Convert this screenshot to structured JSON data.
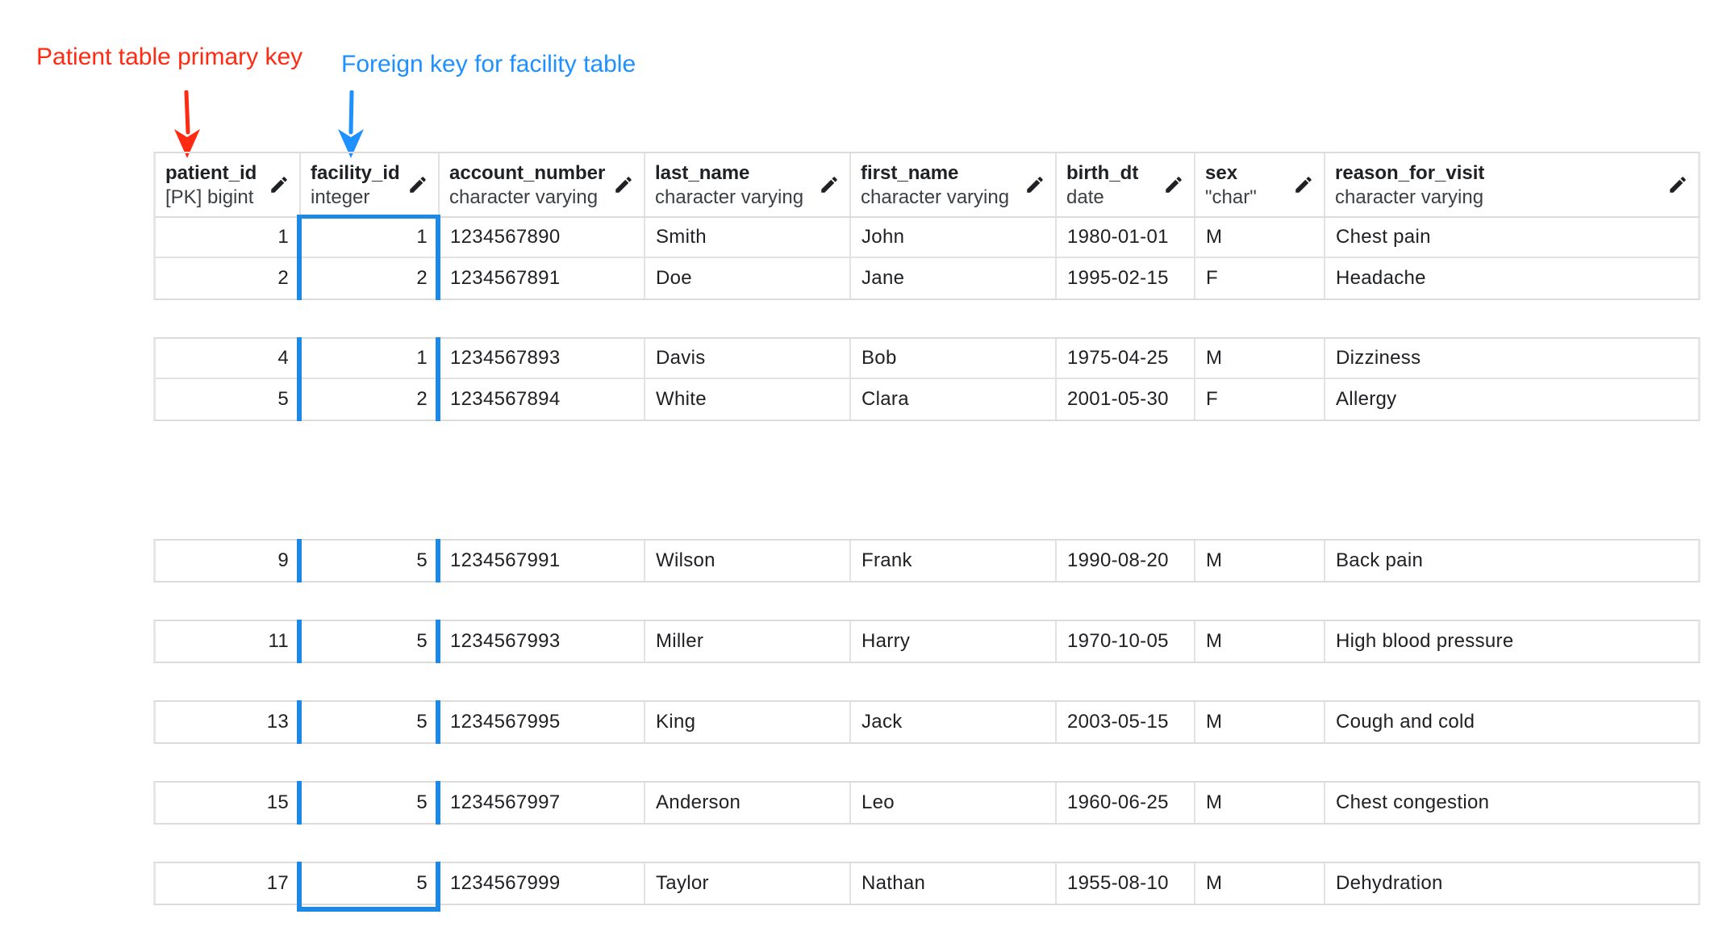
{
  "annotations": {
    "primary_key": "Patient table primary key",
    "foreign_key": "Foreign key for facility table"
  },
  "colors": {
    "primary_key_annotation": "#ff2a12",
    "foreign_key_annotation": "#1e90ff",
    "fk_highlight": "#1e88e5"
  },
  "columns": [
    {
      "name": "patient_id",
      "type": "[PK] bigint"
    },
    {
      "name": "facility_id",
      "type": "integer"
    },
    {
      "name": "account_number",
      "type": "character varying"
    },
    {
      "name": "last_name",
      "type": "character varying"
    },
    {
      "name": "first_name",
      "type": "character varying"
    },
    {
      "name": "birth_dt",
      "type": "date"
    },
    {
      "name": "sex",
      "type": "\"char\""
    },
    {
      "name": "reason_for_visit",
      "type": "character varying"
    }
  ],
  "header_icon": "pencil-icon",
  "rows": [
    [
      "1",
      "1",
      "1234567890",
      "Smith",
      "John",
      "1980-01-01",
      "M",
      "Chest pain"
    ],
    [
      "2",
      "2",
      "1234567891",
      "Doe",
      "Jane",
      "1995-02-15",
      "F",
      "Headache"
    ],
    [
      "4",
      "1",
      "1234567893",
      "Davis",
      "Bob",
      "1975-04-25",
      "M",
      "Dizziness"
    ],
    [
      "5",
      "2",
      "1234567894",
      "White",
      "Clara",
      "2001-05-30",
      "F",
      "Allergy"
    ],
    [
      "9",
      "5",
      "1234567991",
      "Wilson",
      "Frank",
      "1990-08-20",
      "M",
      "Back pain"
    ],
    [
      "11",
      "5",
      "1234567993",
      "Miller",
      "Harry",
      "1970-10-05",
      "M",
      "High blood pressure"
    ],
    [
      "13",
      "5",
      "1234567995",
      "King",
      "Jack",
      "2003-05-15",
      "M",
      "Cough and cold"
    ],
    [
      "15",
      "5",
      "1234567997",
      "Anderson",
      "Leo",
      "1960-06-25",
      "M",
      "Chest congestion"
    ],
    [
      "17",
      "5",
      "1234567999",
      "Taylor",
      "Nathan",
      "1955-08-10",
      "M",
      "Dehydration"
    ]
  ]
}
